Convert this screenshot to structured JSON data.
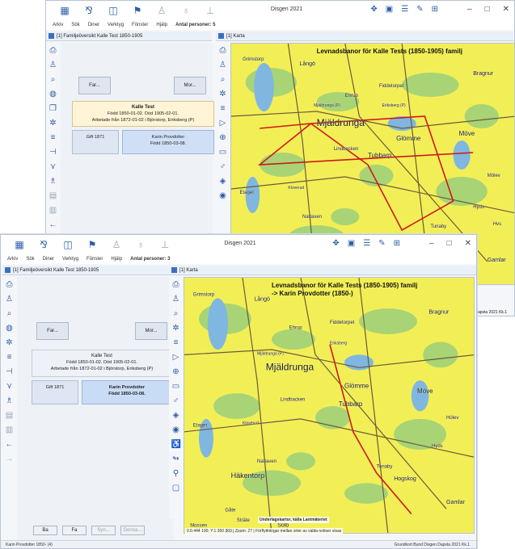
{
  "app": {
    "window_title": "Disgen 2021",
    "menus": [
      "Arkiv",
      "Sök",
      "Diner",
      "Verktyg",
      "Fönster",
      "Hjälp"
    ],
    "persons_label": "Antal personer: 3"
  },
  "back_window": {
    "persons_label": "Antal personer: 5",
    "family_tab": "[1] Familjeöversikt Kalle Test 1850-1905",
    "map_tab": "[1] Karta",
    "map_title": "Levnadsbanor för Kalle Tests (1850-1905) familj",
    "father_button": "Far...",
    "mother_button": "Mor...",
    "person_name": "Kalle Test",
    "person_dates": "Född 1850-01-02. Död 1905-02-01.",
    "person_work": "Arbetade från 1872-01-02 i Björstorp, Eriksberg (P)",
    "marriage": "Gift 1871",
    "spouse_name": "Karin Provdotter",
    "spouse_dates": "Född 1850-03-08.",
    "status_right": "am Dapsta 2021 Kk.1",
    "places": [
      "Grimstorp",
      "Långö",
      "Ehrup",
      "Fiddetorpet",
      "Bragnur",
      "Mjäldrunga (P)",
      "Eriksberg (P)",
      "Mjäldrunga",
      "Glömme",
      "Möve",
      "Tubbarp",
      "Lindbacken",
      "Etaget",
      "Kloverud",
      "Nattaven",
      "Häkentorp",
      "Hogskog",
      "Tunaby",
      "Hyds",
      "Mölev",
      "Hvs",
      "Gamlar"
    ]
  },
  "front_window": {
    "family_tab": "[1] Familjeöversikt Kalle Test 1850-1905",
    "map_tab": "[1] Karta",
    "map_title_line1": "Levnadsbanor för Kalle Tests (1850-1905) familj",
    "map_title_line2": "-> Karin Provdotter (1850-)",
    "father_button": "Far...",
    "mother_button": "Mor...",
    "person_name": "Kalle Test",
    "person_dates": "Född 1850-01-02. Död 1905-02-01.",
    "person_work": "Arbetade från 1872-01-02 i Björstorp, Eriksberg (P)",
    "marriage": "Gift 1871",
    "spouse_name": "Karin Provdotter",
    "spouse_dates": "Född 1850-03-08.",
    "bottom_buttons": [
      "Ba",
      "Fa",
      "Syn...",
      "Denna..."
    ],
    "map_status": "0.6:444 100; Y:1 350 303 | Zoom: 27 | Förflyttningar mellan orter av valda notiser visas",
    "map_caption": "Underlagskartor, källa Lantmäteriet",
    "status_left": "Karin Provdotter 1850- (4)",
    "status_right": "Grundkort Bund Disgen Dapsta 2021 Kk.1",
    "places": [
      "Grimstorp",
      "Långö",
      "Ehrup",
      "Fiddetorpet",
      "Bragnur",
      "Mjäldrunga (P)",
      "Eriksberg",
      "Mjäldrunga",
      "Glömme",
      "Möve",
      "Tubbarp",
      "Lindbacken",
      "Etaget",
      "Kloverud",
      "Nattaven",
      "Häkentorp",
      "Hogskog",
      "Tunaby",
      "Hyds",
      "Hölev",
      "Gåte",
      "Sträte",
      "Mossen",
      "Solb",
      "Platev",
      "Gamlar"
    ]
  },
  "colors": {
    "route_line": "#d01818",
    "map_base": "#f2ef56",
    "forest": "#9bcf7a",
    "water": "#7fb7e0"
  }
}
